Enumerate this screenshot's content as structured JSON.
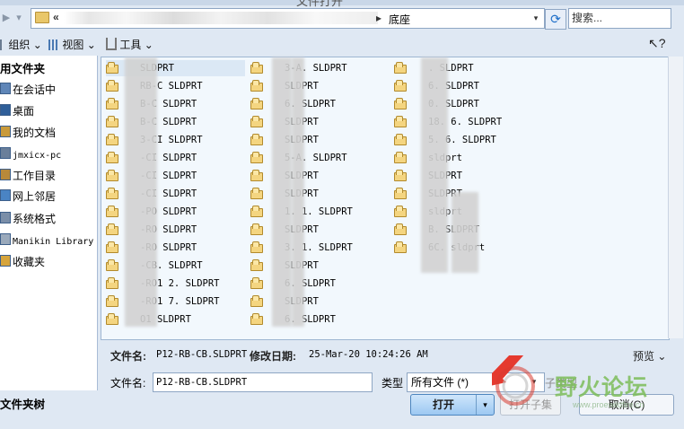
{
  "window": {
    "title": "文件打开"
  },
  "address": {
    "path_tail": "底座",
    "search_placeholder": "搜索..."
  },
  "toolbar": {
    "organize_label": "组织",
    "view_label": "视图",
    "tools_label": "工具",
    "help_icon": "help-icon"
  },
  "sidebar": {
    "favorites_header": "用文件夹",
    "items": [
      {
        "label": "在会话中",
        "icon": "session-icon"
      },
      {
        "label": "桌面",
        "icon": "desktop-icon"
      },
      {
        "label": "我的文档",
        "icon": "documents-icon"
      },
      {
        "label": "jmxicx-pc",
        "icon": "computer-icon"
      },
      {
        "label": "工作目录",
        "icon": "working-dir-icon"
      },
      {
        "label": "网上邻居",
        "icon": "network-icon"
      },
      {
        "label": "系统格式",
        "icon": "system-format-icon"
      },
      {
        "label": "Manikin Library",
        "icon": "manikin-icon"
      },
      {
        "label": "收藏夹",
        "icon": "favorites-icon"
      }
    ],
    "folder_tree_label": "文件夹树"
  },
  "files": {
    "col1": [
      "SLDPRT",
      "RB-C SLDPRT",
      "B-C SLDPRT",
      "B-C SLDPRT",
      "3-CI SLDPRT",
      "-CI SLDPRT",
      "-CI SLDPRT",
      "-CI SLDPRT",
      "-PO SLDPRT",
      "-RO SLDPRT",
      "-RO SLDPRT",
      "-CB. SLDPRT",
      "-RO1 2. SLDPRT",
      "-RO1 7. SLDPRT",
      "O1 SLDPRT"
    ],
    "col2": [
      "3-A. SLDPRT",
      "SLDPRT",
      "6. SLDPRT",
      "SLDPRT",
      "SLDPRT",
      "5-A. SLDPRT",
      "SLDPRT",
      "SLDPRT",
      "1. 1. SLDPRT",
      "SLDPRT",
      "3. 1. SLDPRT",
      "SLDPRT",
      "6. SLDPRT",
      "SLDPRT",
      "6. SLDPRT"
    ],
    "col3": [
      ". SLDPRT",
      "6. SLDPRT",
      "0. SLDPRT",
      "18. 6. SLDPRT",
      "5. 6. SLDPRT",
      "sldprt",
      "SLDPRT",
      "SLDPRT",
      "sldprt",
      "B. SLDPRT",
      "6C. sldprt"
    ]
  },
  "details": {
    "filename_label": "文件名:",
    "filename_value": "P12-RB-CB.SLDPRT",
    "modified_label": "修改日期:",
    "modified_value": "25-Mar-20 10:24:26 AM",
    "preview_label": "预览"
  },
  "bottom": {
    "filename_label": "文件名:",
    "filename_value": "P12-RB-CB.SLDPRT",
    "type_label": "类型",
    "type_value": "所有文件 (*)",
    "subtype_label": "子类型",
    "open_label": "打开",
    "open_subset_label": "打开子集",
    "cancel_label": "取消(C)"
  },
  "watermark": {
    "text": "野火论坛",
    "url": "www.proewildfire.cn"
  }
}
